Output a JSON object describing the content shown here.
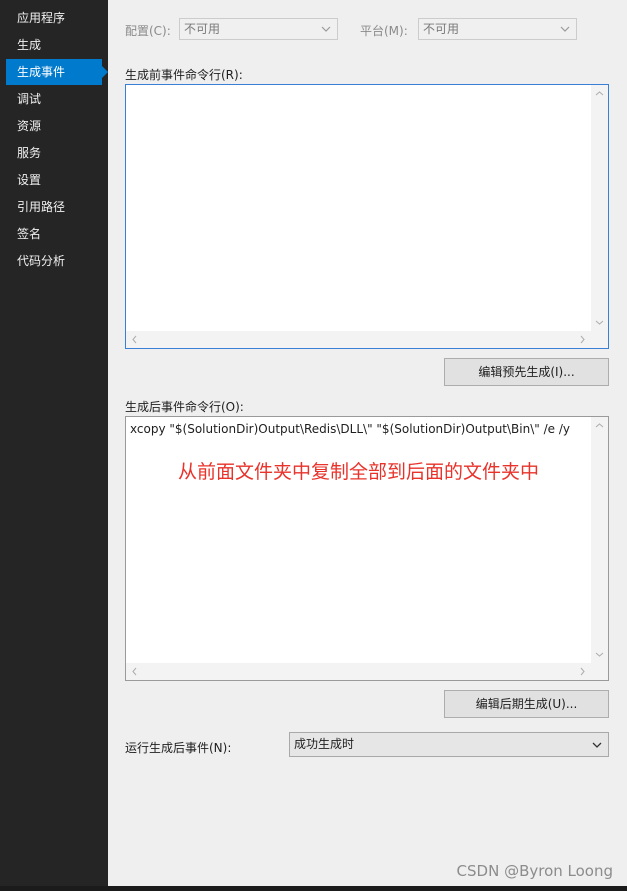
{
  "sidebar": {
    "items": [
      {
        "label": "应用程序"
      },
      {
        "label": "生成"
      },
      {
        "label": "生成事件",
        "active": true
      },
      {
        "label": "调试"
      },
      {
        "label": "资源"
      },
      {
        "label": "服务"
      },
      {
        "label": "设置"
      },
      {
        "label": "引用路径"
      },
      {
        "label": "签名"
      },
      {
        "label": "代码分析"
      }
    ]
  },
  "config": {
    "label": "配置(C):",
    "value": "不可用",
    "platform_label": "平台(M):",
    "platform_value": "不可用"
  },
  "prebuild": {
    "label": "生成前事件命令行(R):",
    "value": "",
    "edit_button": "编辑预先生成(I)..."
  },
  "postbuild": {
    "label": "生成后事件命令行(O):",
    "value": "xcopy \"$(SolutionDir)Output\\Redis\\DLL\\\" \"$(SolutionDir)Output\\Bin\\\" /e /y",
    "annotation": "从前面文件夹中复制全部到后面的文件夹中",
    "edit_button": "编辑后期生成(U)..."
  },
  "run_post_event": {
    "label": "运行生成后事件(N):",
    "value": "成功生成时"
  },
  "watermark": "CSDN @Byron Loong",
  "icons": {
    "dropdown": "chevron-down-icon",
    "scroll_up": "chevron-up-icon",
    "scroll_down": "chevron-down-icon",
    "scroll_left": "chevron-left-icon",
    "scroll_right": "chevron-right-icon"
  },
  "colors": {
    "accent": "#007acc",
    "sidebar_bg": "#252526",
    "panel_bg": "#efefef",
    "annotation": "#e8322a"
  }
}
